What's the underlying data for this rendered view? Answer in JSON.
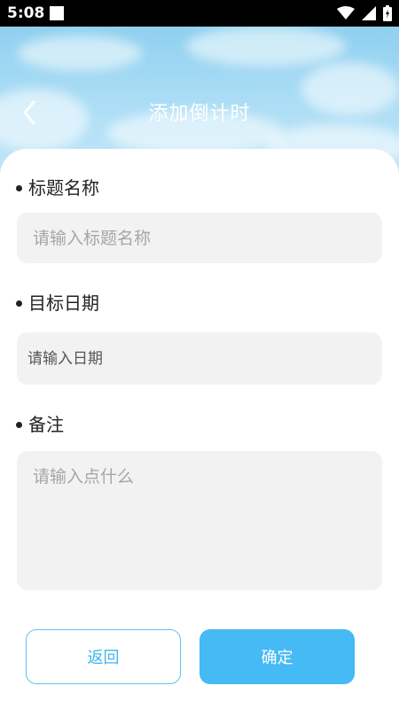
{
  "status_bar": {
    "time": "5:08"
  },
  "header": {
    "title": "添加倒计时",
    "back_icon": "chevron-left-icon"
  },
  "form": {
    "title_field": {
      "label": "标题名称",
      "value": "",
      "placeholder": "请输入标题名称"
    },
    "date_field": {
      "label": "目标日期",
      "value": "",
      "placeholder": "请输入日期"
    },
    "note_field": {
      "label": "备注",
      "value": "",
      "placeholder": "请输入点什么"
    }
  },
  "actions": {
    "back_label": "返回",
    "confirm_label": "确定"
  },
  "colors": {
    "accent": "#45baf4",
    "accent_outline": "#5cc3f0",
    "input_bg": "#f2f2f2"
  }
}
